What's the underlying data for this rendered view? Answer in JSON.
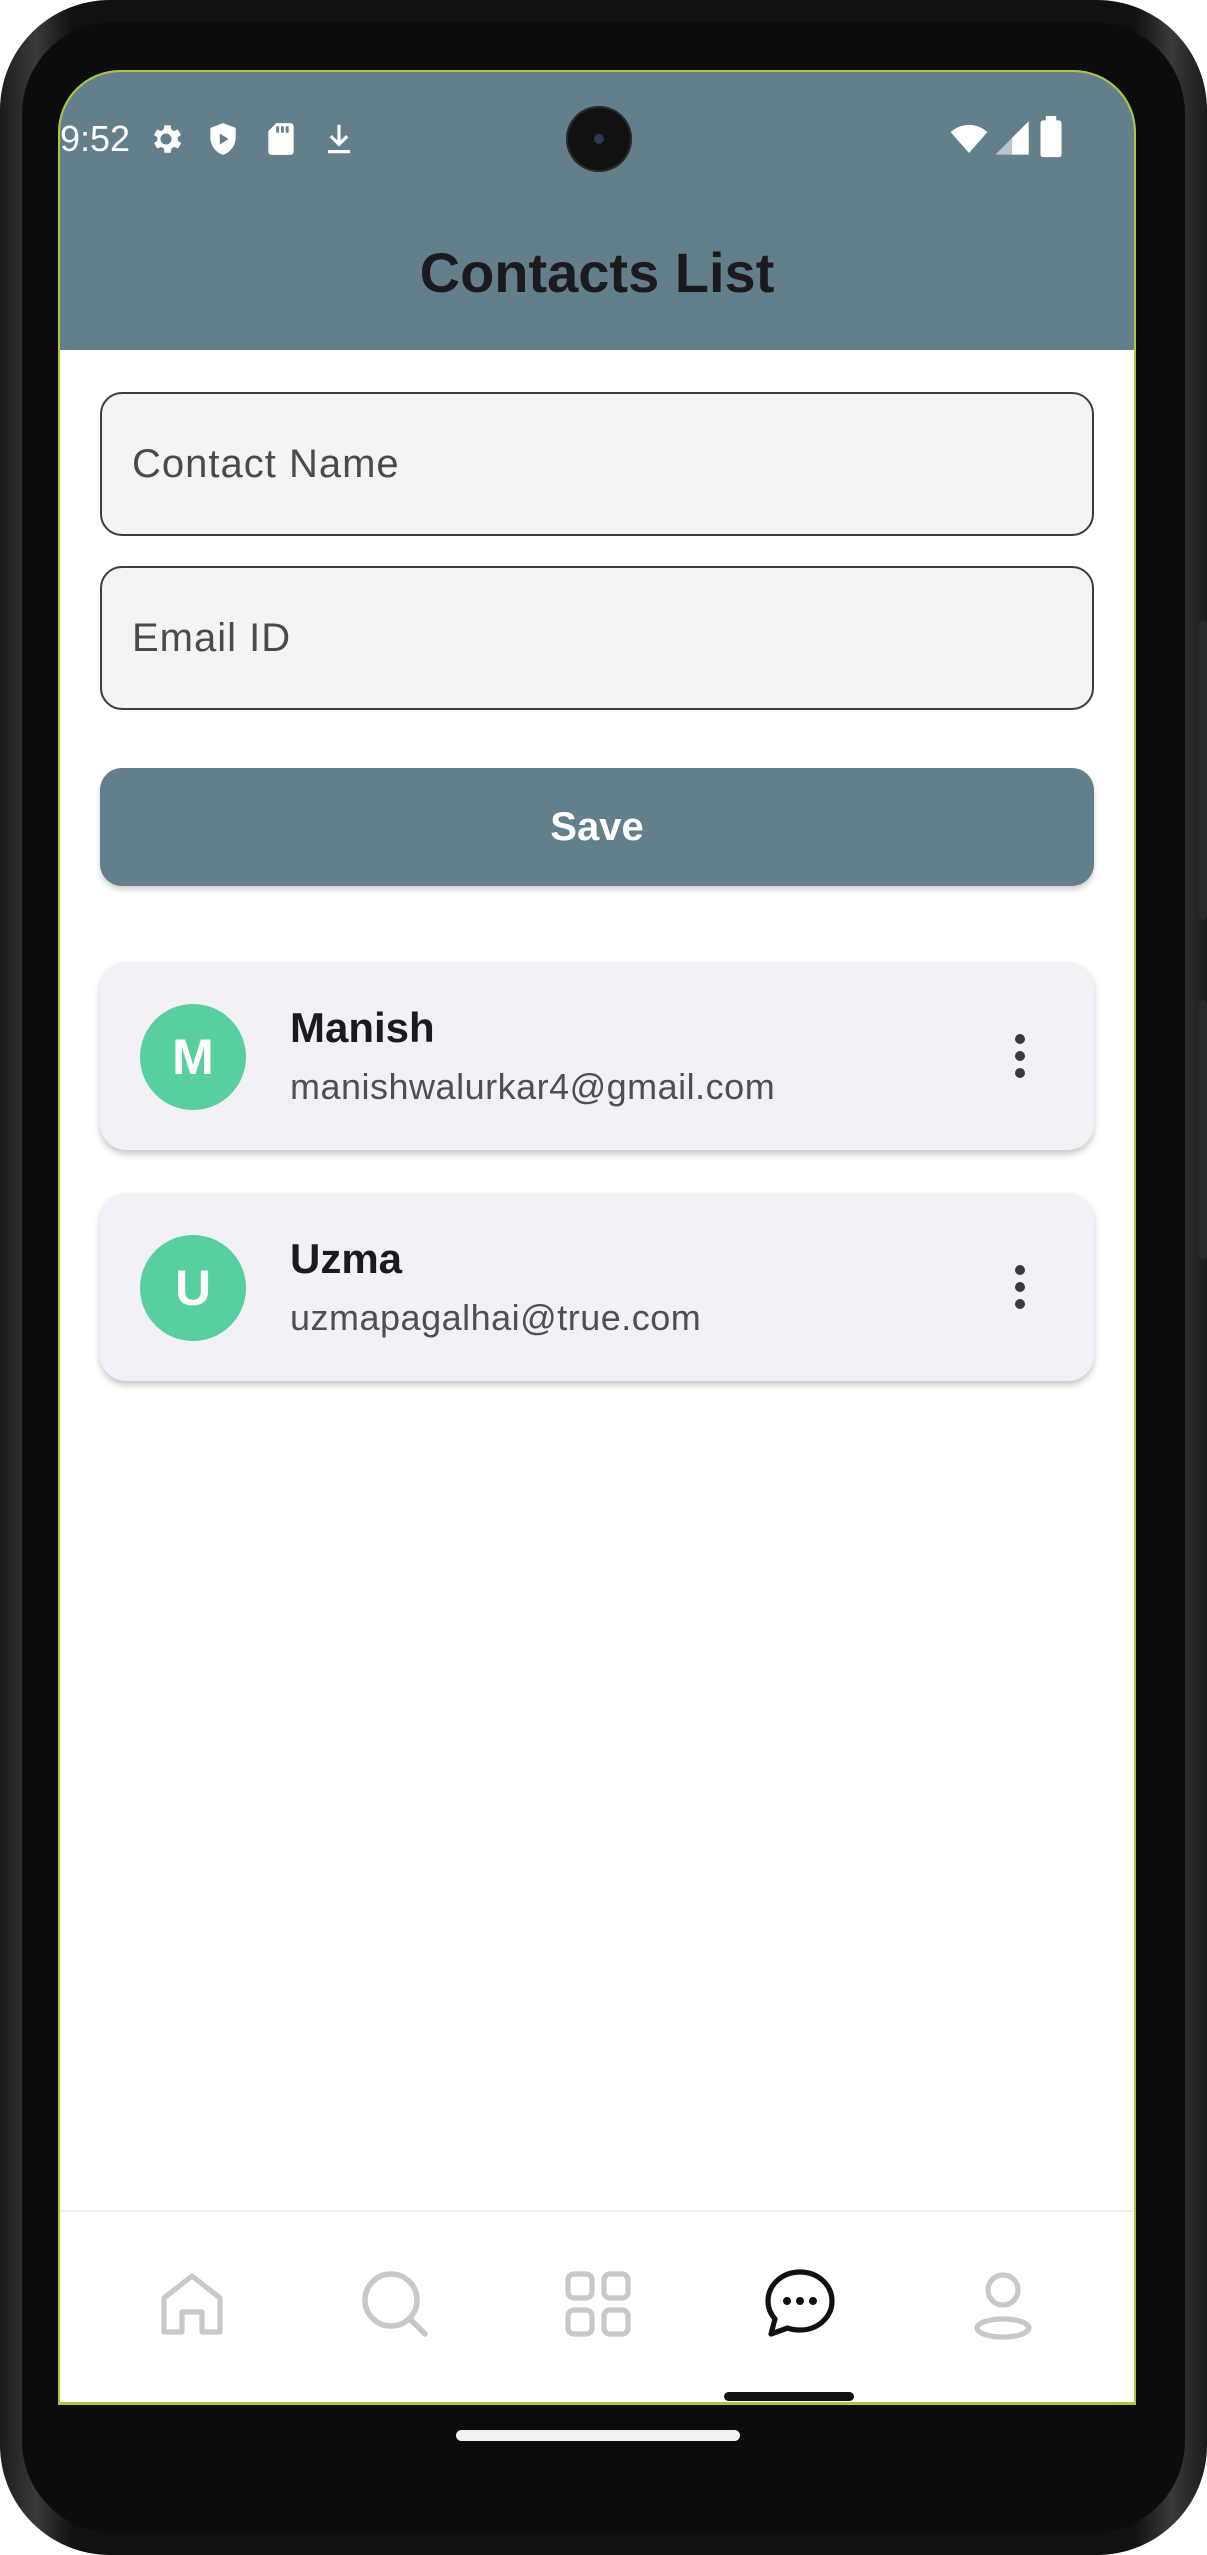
{
  "status_bar": {
    "time": "9:52",
    "left_icons": [
      "gear-icon",
      "shield-icon",
      "sd-card-icon",
      "download-icon"
    ],
    "right_icons": [
      "wifi-icon",
      "signal-icon",
      "battery-icon"
    ]
  },
  "header": {
    "title": "Contacts List",
    "bg_color": "#647f8c"
  },
  "form": {
    "name_placeholder": "Contact Name",
    "name_value": "",
    "email_placeholder": "Email ID",
    "email_value": "",
    "save_label": "Save"
  },
  "contacts": [
    {
      "initial": "M",
      "name": "Manish",
      "email": "manishwalurkar4@gmail.com"
    },
    {
      "initial": "U",
      "name": "Uzma",
      "email": "uzmapagalhai@true.com"
    }
  ],
  "avatar_color": "#57cf9e",
  "bottom_nav": {
    "items": [
      "home-icon",
      "search-icon",
      "grid-icon",
      "chat-icon",
      "profile-icon"
    ],
    "selected": "chat-icon"
  }
}
